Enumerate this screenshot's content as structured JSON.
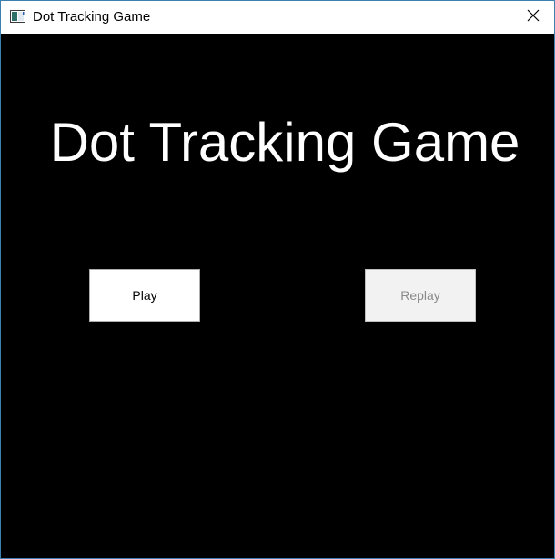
{
  "window": {
    "title": "Dot Tracking Game",
    "icon": "app-window-icon",
    "close_icon": "close-icon"
  },
  "main": {
    "heading": "Dot Tracking Game",
    "play_label": "Play",
    "replay_label": "Replay",
    "replay_enabled": false
  },
  "colors": {
    "background": "#000000",
    "heading": "#ffffff",
    "titlebar": "#ffffff",
    "window_border": "#3c7fb1"
  }
}
